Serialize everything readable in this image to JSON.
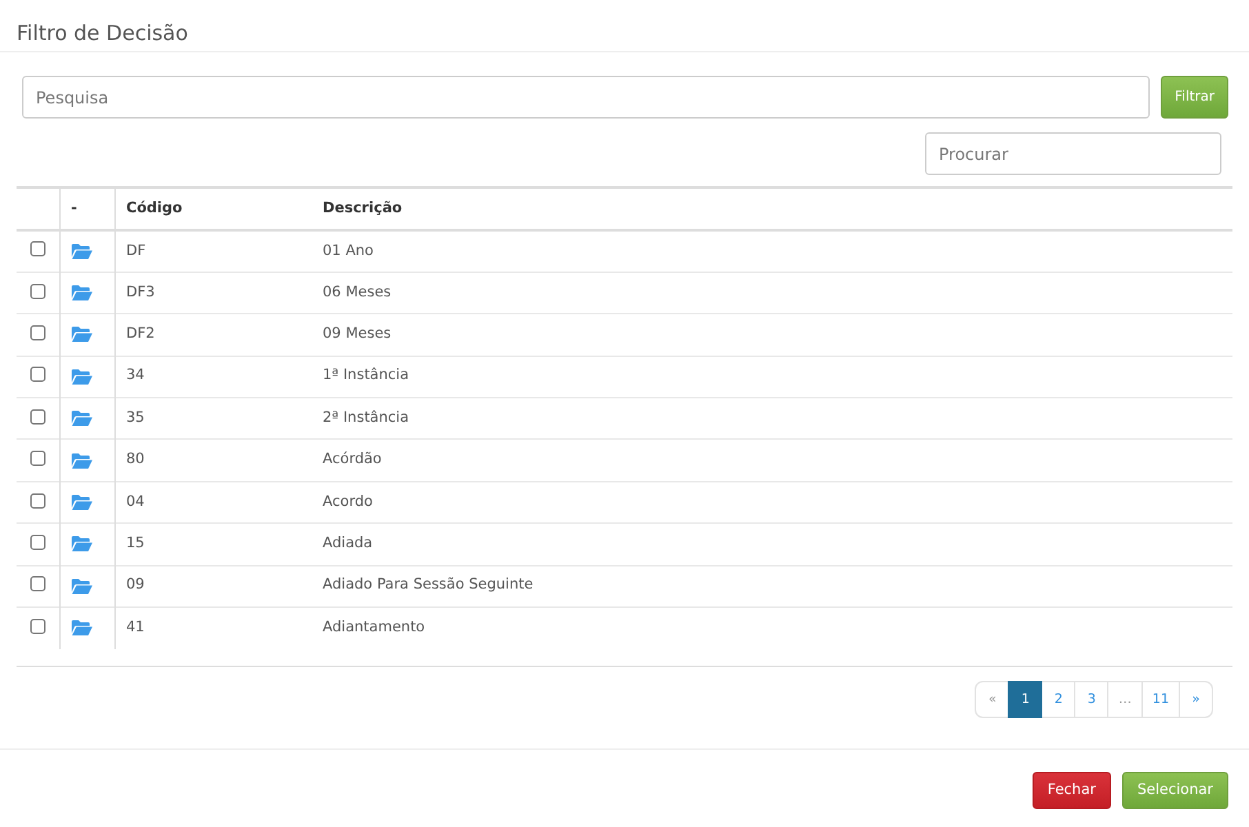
{
  "dialog": {
    "title": "Filtro de Decisão"
  },
  "filter": {
    "search": {
      "placeholder": "Pesquisa"
    },
    "button": "Filtrar"
  },
  "table_search": {
    "placeholder": "Procurar"
  },
  "table": {
    "columns": [
      "-",
      "Código",
      "Descrição"
    ],
    "rows": [
      {
        "checked": false,
        "code": "DF",
        "description": "01 Ano"
      },
      {
        "checked": false,
        "code": "DF3",
        "description": "06 Meses"
      },
      {
        "checked": false,
        "code": "DF2",
        "description": "09 Meses"
      },
      {
        "checked": false,
        "code": "34",
        "description": "1ª Instância"
      },
      {
        "checked": false,
        "code": "35",
        "description": "2ª Instância"
      },
      {
        "checked": false,
        "code": "80",
        "description": "Acórdão"
      },
      {
        "checked": false,
        "code": "04",
        "description": "Acordo"
      },
      {
        "checked": false,
        "code": "15",
        "description": "Adiada"
      },
      {
        "checked": false,
        "code": "09",
        "description": "Adiado Para Sessão Seguinte"
      },
      {
        "checked": false,
        "code": "41",
        "description": "Adiantamento"
      }
    ]
  },
  "pagination": [
    {
      "label": "«",
      "selected": false,
      "disabled": true
    },
    {
      "label": "1",
      "selected": true,
      "disabled": false
    },
    {
      "label": "2",
      "selected": false,
      "disabled": false
    },
    {
      "label": "3",
      "selected": false,
      "disabled": false
    },
    {
      "label": "…",
      "selected": false,
      "disabled": true
    },
    {
      "label": "11",
      "selected": false,
      "disabled": false
    },
    {
      "label": "»",
      "selected": false,
      "disabled": false
    }
  ],
  "buttons": [
    {
      "label": "Fechar",
      "kind": "danger"
    },
    {
      "label": "Selecionar",
      "kind": "success"
    }
  ]
}
